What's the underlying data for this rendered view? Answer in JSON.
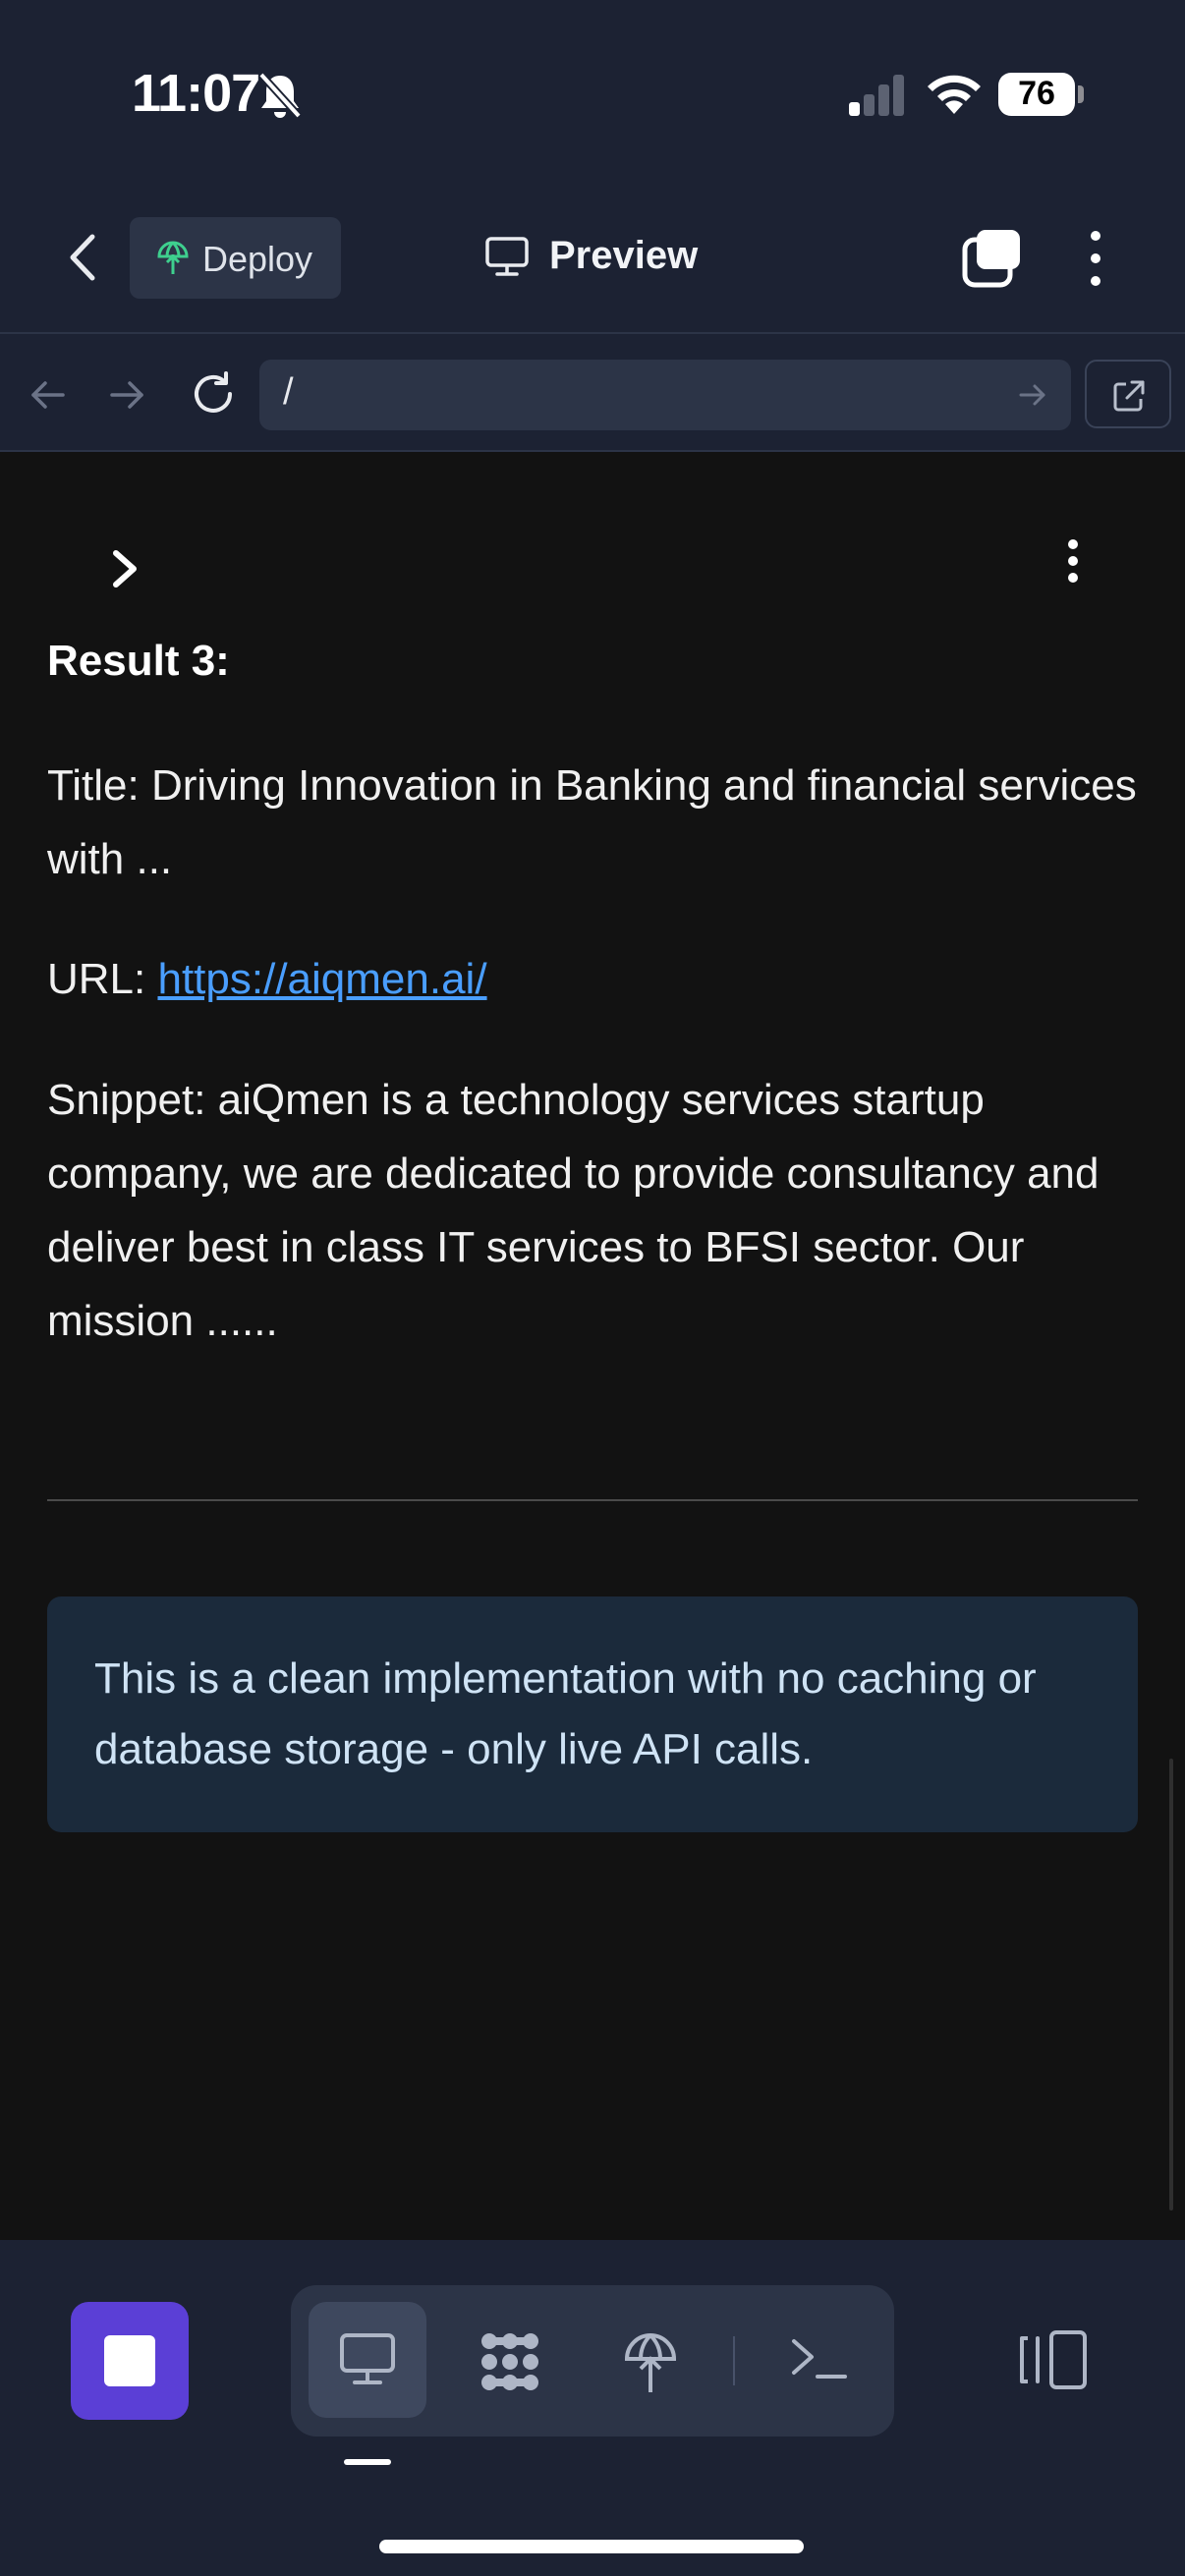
{
  "status_bar": {
    "time": "11:07",
    "battery": "76"
  },
  "toolbar": {
    "deploy_label": "Deploy",
    "preview_label": "Preview"
  },
  "url_bar": {
    "url": "/"
  },
  "content": {
    "result_heading": "Result 3:",
    "title_line": "Title: Driving Innovation in Banking and financial services with ...",
    "url_prefix": "URL: ",
    "url_link": "https://aiqmen.ai/",
    "snippet": "Snippet: aiQmen is a technology services startup company, we are dedicated to provide consultancy and deliver best in class IT services to BFSI sector. Our mission ......",
    "info_text": "This is a clean implementation with no caching or database storage - only live API calls."
  },
  "icons": {
    "status": [
      "bell-slash-icon",
      "signal-icon",
      "wifi-icon",
      "battery-icon"
    ],
    "toolbar": [
      "chevron-left-icon",
      "deploy-icon",
      "monitor-icon",
      "tabs-icon",
      "more-vertical-icon"
    ],
    "url_bar": [
      "arrow-left-icon",
      "arrow-right-icon",
      "reload-icon",
      "arrow-right-icon",
      "external-link-icon"
    ],
    "bottom_bar": [
      "stop-icon",
      "monitor-icon",
      "dots-grid-icon",
      "deploy-icon",
      "terminal-icon",
      "side-panel-icon"
    ]
  },
  "colors": {
    "accent": "#5b3fd6",
    "link": "#4a9eff",
    "info_bg": "#1b2a3b",
    "chrome_bg": "#1c2233",
    "content_bg": "#121212"
  }
}
